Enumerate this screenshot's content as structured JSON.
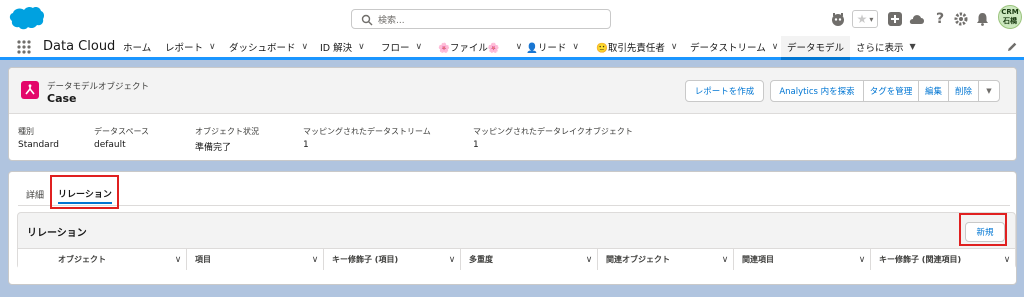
{
  "search": {
    "placeholder": "検索..."
  },
  "profile": {
    "line1": "CRM",
    "line2": "石橋"
  },
  "nav": {
    "app_name": "Data Cloud",
    "items": [
      {
        "label": "ホーム",
        "chevron": false
      },
      {
        "label": "レポート",
        "chevron": true
      },
      {
        "label": "ダッシュボード",
        "chevron": true
      },
      {
        "label": "ID 解決",
        "chevron": true
      },
      {
        "label": "フロー",
        "chevron": true
      },
      {
        "label": "🌸ファイル🌸",
        "chevron": true
      },
      {
        "label": "👤リード",
        "chevron": true
      },
      {
        "label": "🙂取引先責任者",
        "chevron": true
      },
      {
        "label": "データストリーム",
        "chevron": true
      },
      {
        "label": "データモデル",
        "chevron": false,
        "active": true
      },
      {
        "label": "さらに表示",
        "chevron": true
      }
    ]
  },
  "record": {
    "object_type": "データモデルオブジェクト",
    "name": "Case",
    "buttons": {
      "create_report": "レポートを作成",
      "explore_analytics": "Analytics 内を探索",
      "manage_tags": "タグを管理",
      "edit": "編集",
      "delete": "削除"
    },
    "fields": [
      {
        "label": "種別",
        "value": "Standard"
      },
      {
        "label": "データスペース",
        "value": "default"
      },
      {
        "label": "オブジェクト状況",
        "value": "準備完了"
      },
      {
        "label": "マッピングされたデータストリーム",
        "value": "1"
      },
      {
        "label": "マッピングされたデータレイクオブジェクト",
        "value": "1"
      }
    ]
  },
  "tabs": [
    {
      "label": "詳細",
      "active": false
    },
    {
      "label": "リレーション",
      "active": true
    }
  ],
  "relations": {
    "title": "リレーション",
    "new_button": "新規",
    "columns": [
      "オブジェクト",
      "項目",
      "キー修飾子 (項目)",
      "多重度",
      "関連オブジェクト",
      "関連項目",
      "キー修飾子 (関連項目)"
    ]
  },
  "colors": {
    "brand_blue": "#0176d3",
    "highlight_red": "#e02020",
    "object_icon": "#e3066a"
  }
}
